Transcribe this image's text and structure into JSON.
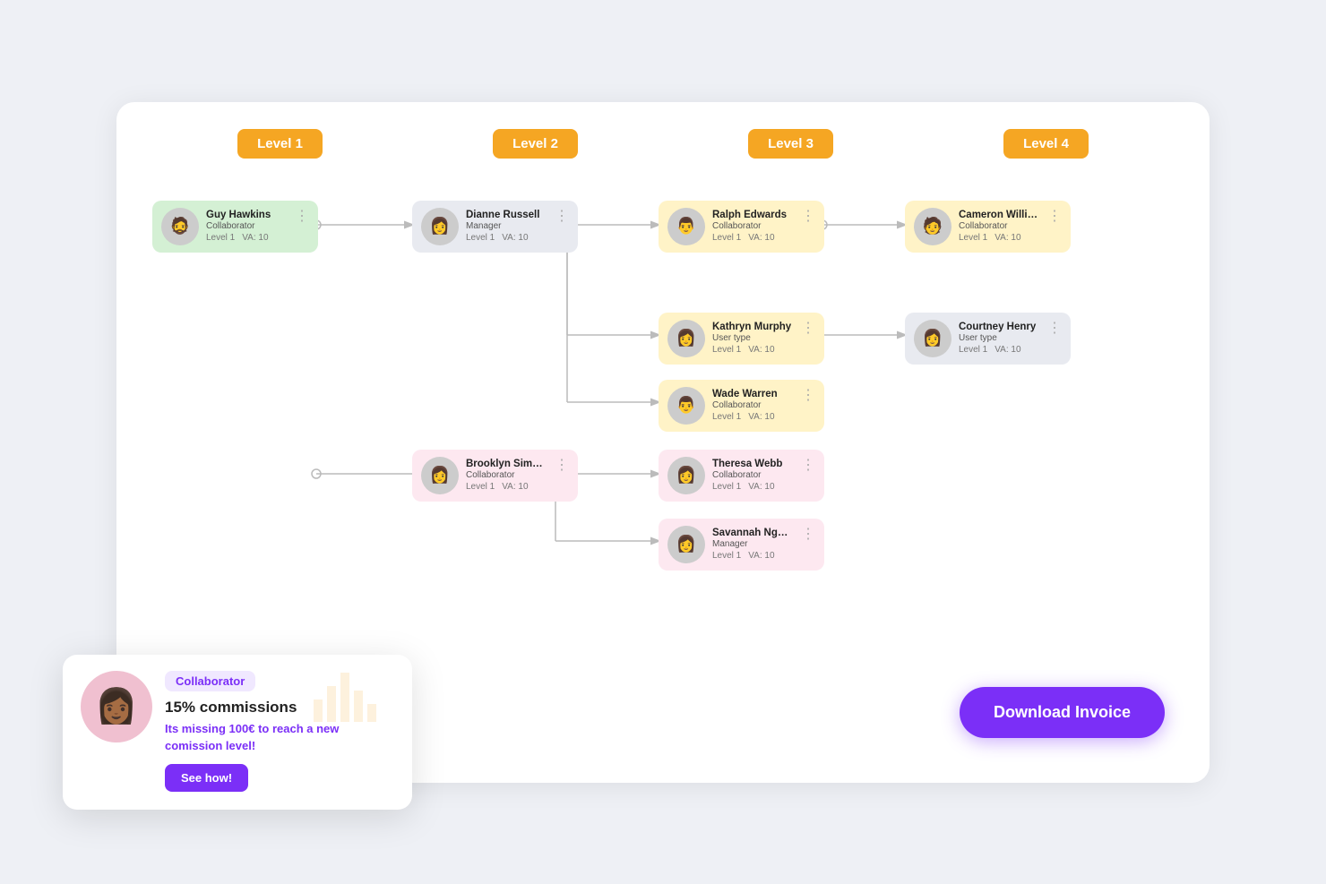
{
  "levels": [
    {
      "id": "l1",
      "label": "Level 1"
    },
    {
      "id": "l2",
      "label": "Level 2"
    },
    {
      "id": "l3",
      "label": "Level 3"
    },
    {
      "id": "l4",
      "label": "Level 4"
    }
  ],
  "cards": [
    {
      "id": "guy",
      "name": "Guy Hawkins",
      "role": "Collaborator",
      "level": "Level 1",
      "va": "VA: 10",
      "color": "card-green",
      "emoji": "👨"
    },
    {
      "id": "dianne",
      "name": "Dianne Russell",
      "role": "Manager",
      "level": "Level 1",
      "va": "VA: 10",
      "color": "card-gray",
      "emoji": "👩"
    },
    {
      "id": "ralph",
      "name": "Ralph Edwards",
      "role": "Collaborator",
      "level": "Level 1",
      "va": "VA: 10",
      "color": "card-yellow",
      "emoji": "👨"
    },
    {
      "id": "cameron",
      "name": "Cameron Williamson",
      "role": "Collaborator",
      "level": "Level 1",
      "va": "VA: 10",
      "color": "card-yellow",
      "emoji": "👨"
    },
    {
      "id": "kathryn",
      "name": "Kathryn Murphy",
      "role": "User type",
      "level": "Level 1",
      "va": "VA: 10",
      "color": "card-yellow",
      "emoji": "👩"
    },
    {
      "id": "courtney",
      "name": "Courtney Henry",
      "role": "User type",
      "level": "Level 1",
      "va": "VA: 10",
      "color": "card-gray",
      "emoji": "👩"
    },
    {
      "id": "wade",
      "name": "Wade Warren",
      "role": "Collaborator",
      "level": "Level 1",
      "va": "VA: 10",
      "color": "card-yellow",
      "emoji": "👨"
    },
    {
      "id": "brooklyn",
      "name": "Brooklyn Simmons",
      "role": "Collaborator",
      "level": "Level 1",
      "va": "VA: 10",
      "color": "card-pink",
      "emoji": "👩"
    },
    {
      "id": "theresa",
      "name": "Theresa Webb",
      "role": "Collaborator",
      "level": "Level 1",
      "va": "VA: 10",
      "color": "card-pink",
      "emoji": "👩"
    },
    {
      "id": "savannah",
      "name": "Savannah Nguyen",
      "role": "Manager",
      "level": "Level 1",
      "va": "VA: 10",
      "color": "card-pink",
      "emoji": "👩"
    }
  ],
  "download_button": "Download Invoice",
  "overlay": {
    "badge": "Collaborator",
    "commission_title": "15% commissions",
    "description": "Its missing ",
    "amount": "100€",
    "description_end": " to reach a new comission level!",
    "button_label": "See how!"
  }
}
